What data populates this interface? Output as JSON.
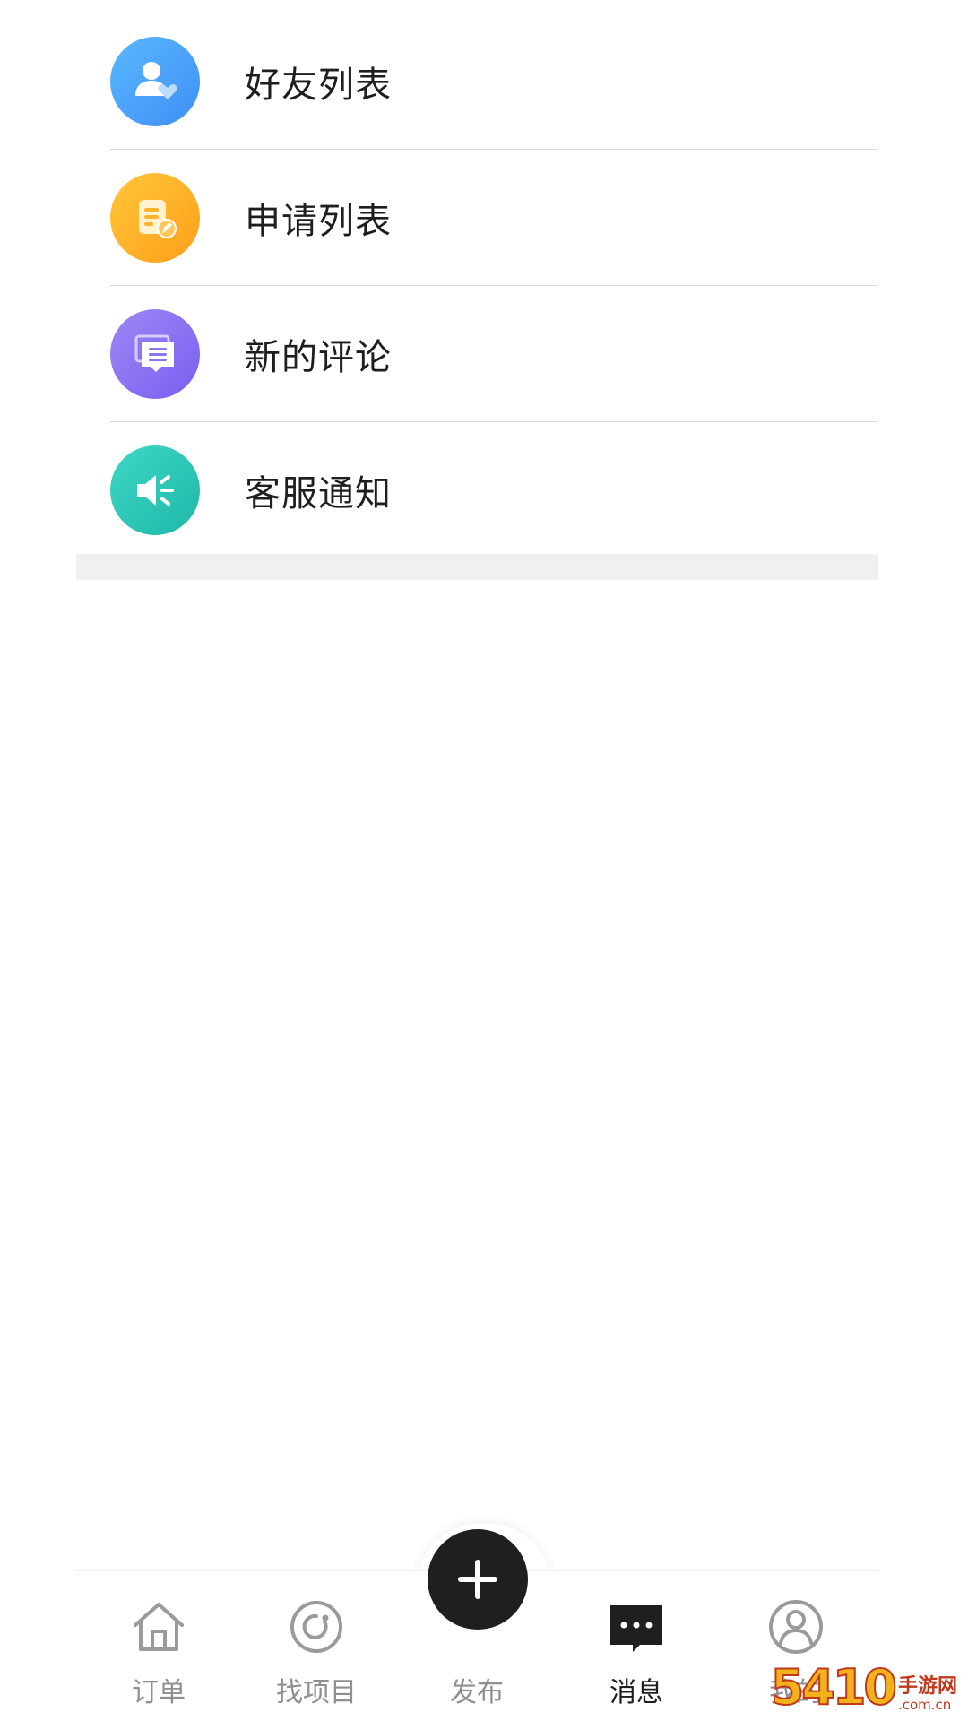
{
  "messages": {
    "items": [
      {
        "label": "好友列表",
        "icon": "friend-list-icon",
        "color_start": "#5ab8ff",
        "color_end": "#3f8ff5"
      },
      {
        "label": "申请列表",
        "icon": "application-list-icon",
        "color_start": "#ffc63a",
        "color_end": "#ff9f1a"
      },
      {
        "label": "新的评论",
        "icon": "comment-icon",
        "color_start": "#9d87f5",
        "color_end": "#7a5ff0"
      },
      {
        "label": "客服通知",
        "icon": "speaker-icon",
        "color_start": "#3ed7c6",
        "color_end": "#1fb8a8"
      }
    ]
  },
  "tabbar": {
    "tabs": [
      {
        "label": "订单",
        "icon": "home-icon",
        "active": false
      },
      {
        "label": "找项目",
        "icon": "refresh-circle-icon",
        "active": false
      },
      {
        "label": "发布",
        "icon": "plus-icon",
        "active": false
      },
      {
        "label": "消息",
        "icon": "message-bubble-icon",
        "active": true
      },
      {
        "label": "我的",
        "icon": "user-circle-icon",
        "active": false
      }
    ],
    "active_color": "#1e1e1e",
    "inactive_color": "#8f8f8f"
  },
  "watermark": {
    "number": "5410",
    "text": "手游网",
    "domain": ".com.cn"
  }
}
